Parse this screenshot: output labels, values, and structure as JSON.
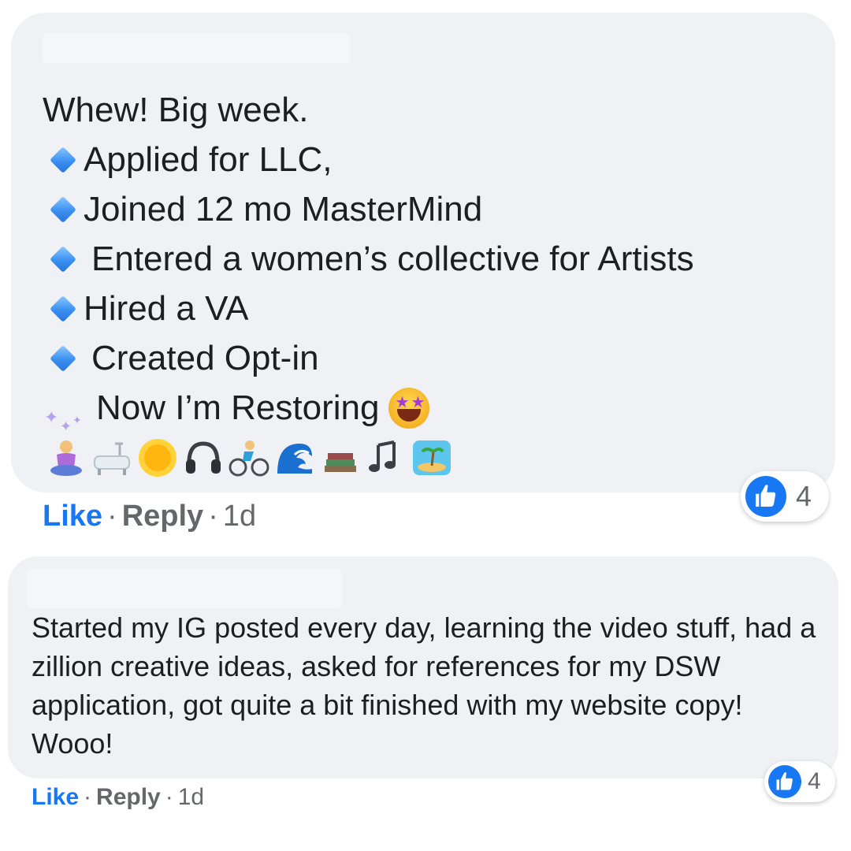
{
  "colors": {
    "bubble": "#eff1f4",
    "like_blue": "#1877f2",
    "meta_gray": "#65676b",
    "text": "#1c1e21",
    "diamond": "#3a8ff0"
  },
  "comment1": {
    "first_line": "Whew! Big week.",
    "items": [
      "Applied for LLC,",
      "Joined 12 mo MasterMind",
      "Entered a women’s collective for Artists",
      "Hired a VA",
      "Created Opt-in"
    ],
    "restoring": "Now I’m Restoring",
    "bullet_icon": "blue-diamond-icon",
    "emoji_icons": [
      "woman-meditating-icon",
      "bathtub-icon",
      "sun-icon",
      "headphones-icon",
      "person-biking-icon",
      "wave-icon",
      "books-icon",
      "musical-notes-icon",
      "desert-island-icon"
    ],
    "actions": {
      "like": "Like",
      "reply": "Reply",
      "time": "1d",
      "sep": "·"
    },
    "reaction_count": "4"
  },
  "comment2": {
    "text": "Started my IG posted every day, learning the video stuff, had a zillion creative ideas, asked for references for my DSW application, got quite a bit finished with my website copy! Wooo!",
    "actions": {
      "like": "Like",
      "reply": "Reply",
      "time": "1d",
      "sep": "·"
    },
    "reaction_count": "4"
  }
}
